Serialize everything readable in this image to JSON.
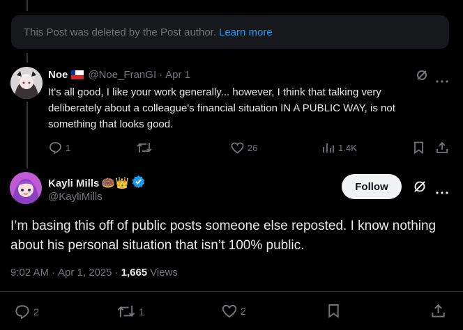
{
  "deleted_notice": {
    "text": "This Post was deleted by the Post author.",
    "link": "Learn more"
  },
  "reply": {
    "name": "Noe",
    "handle": "@Noe_FranGI",
    "separator": "·",
    "date": "Apr 1",
    "text_line1": "It's all good, I like your work generally... however, I think that talking very",
    "text_line2": "deliberately about a colleague's financial situation IN A PUBLIC WAY, is not",
    "text_line3": "something that looks good.",
    "replies": "1",
    "reposts": "",
    "likes": "26",
    "views": "1.4K"
  },
  "main_post": {
    "name": "Kayli Mills",
    "name_emojis": "🍩👑",
    "handle": "@KayliMills",
    "follow_label": "Follow",
    "text_line1": "I’m basing this off of public posts someone else reposted. I know nothing",
    "text_line2": "about his personal situation that isn’t 100% public.",
    "time": "9:02 AM",
    "date": "Apr 1, 2025",
    "views_count": "1,665",
    "views_label": "Views",
    "replies": "2",
    "reposts": "1",
    "likes": "2"
  },
  "colors": {
    "background": "#000000",
    "accent": "#1d9bf0",
    "muted": "#71767b",
    "text": "#e7e9ea"
  },
  "icons": [
    "reply-icon",
    "repost-icon",
    "like-icon",
    "views-icon",
    "bookmark-icon",
    "share-icon",
    "grok-icon",
    "more-icon",
    "verified-badge-icon"
  ]
}
